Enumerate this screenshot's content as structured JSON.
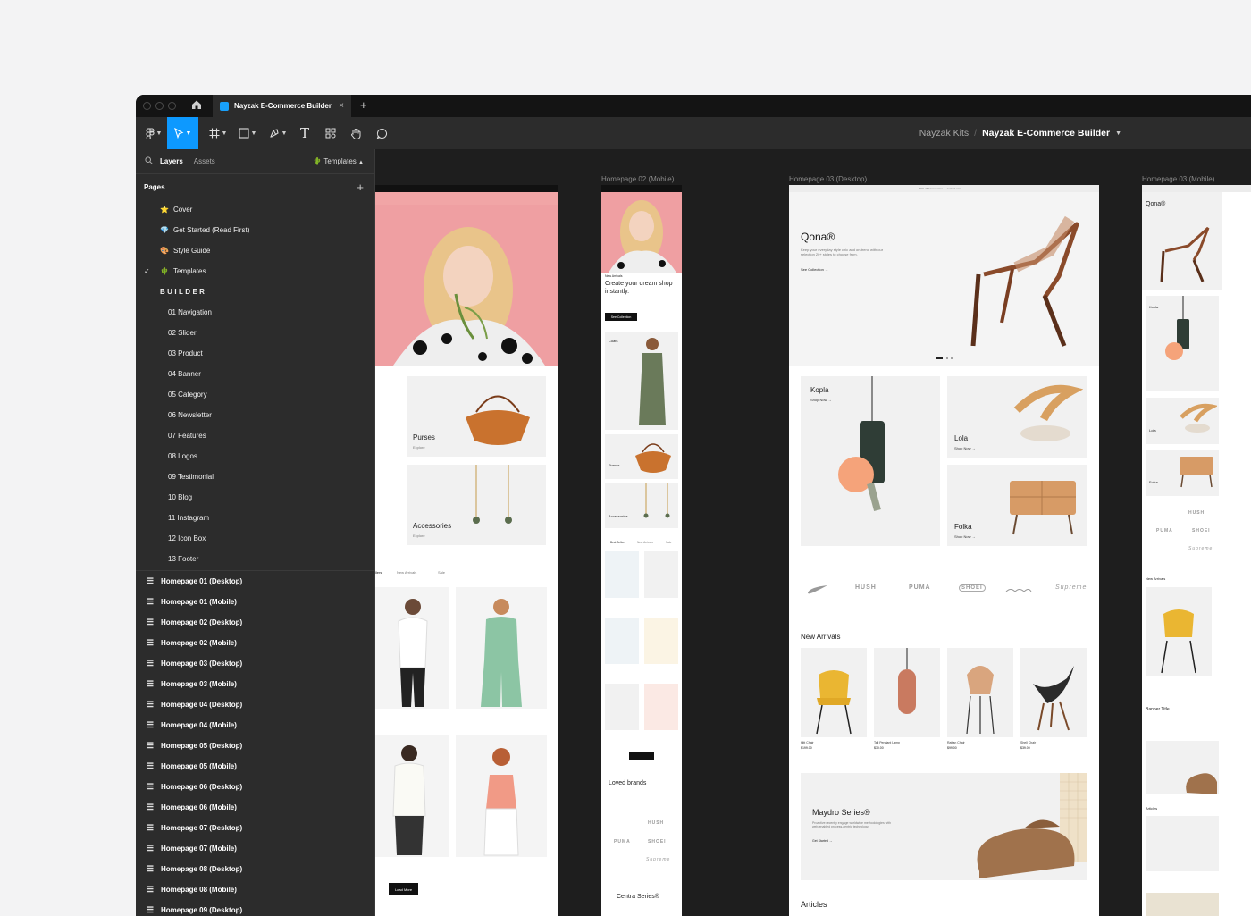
{
  "window": {
    "tab_title": "Nayzak E-Commerce Builder",
    "tab_close": "×",
    "new_tab": "+"
  },
  "toolbar": {
    "tools": [
      "figma-menu",
      "move",
      "frame",
      "shape",
      "pen",
      "text",
      "resources",
      "hand",
      "comment"
    ],
    "text_tool_glyph": "T",
    "breadcrumb_project": "Nayzak Kits",
    "breadcrumb_separator": "/",
    "breadcrumb_file": "Nayzak E-Commerce Builder",
    "accent": "#0d99ff"
  },
  "panel": {
    "tab_layers": "Layers",
    "tab_assets": "Assets",
    "current_page": "Templates",
    "pages_heading": "Pages",
    "add_glyph": "+",
    "pages": [
      {
        "label": "Cover",
        "emoji": "⭐",
        "indent": 1
      },
      {
        "label": "Get Started (Read First)",
        "emoji": "💎",
        "indent": 1
      },
      {
        "label": "Style Guide",
        "emoji": "🎨",
        "indent": 1
      },
      {
        "label": "Templates",
        "emoji": "🌵",
        "indent": 1,
        "checked": true
      },
      {
        "label": "BUILDER",
        "emoji": "",
        "indent": 1,
        "section": true
      },
      {
        "label": "01 Navigation",
        "indent": 2
      },
      {
        "label": "02  Slider",
        "indent": 2
      },
      {
        "label": "03  Product",
        "indent": 2
      },
      {
        "label": "04  Banner",
        "indent": 2
      },
      {
        "label": "05  Category",
        "indent": 2
      },
      {
        "label": "06 Newsletter",
        "indent": 2
      },
      {
        "label": "07 Features",
        "indent": 2
      },
      {
        "label": "08 Logos",
        "indent": 2
      },
      {
        "label": "09  Testimonial",
        "indent": 2
      },
      {
        "label": "10  Blog",
        "indent": 2
      },
      {
        "label": "11  Instagram",
        "indent": 2
      },
      {
        "label": "12 Icon Box",
        "indent": 2
      },
      {
        "label": "13  Footer",
        "indent": 2
      }
    ],
    "frames": [
      "Homepage 01 (Desktop)",
      "Homepage 01 (Mobile)",
      "Homepage 02 (Desktop)",
      "Homepage 02 (Mobile)",
      "Homepage 03 (Desktop)",
      "Homepage 03 (Mobile)",
      "Homepage 04 (Desktop)",
      "Homepage 04 (Mobile)",
      "Homepage 05 (Desktop)",
      "Homepage 05 (Mobile)",
      "Homepage 06 (Desktop)",
      "Homepage 06 (Mobile)",
      "Homepage 07 (Desktop)",
      "Homepage 07 (Mobile)",
      "Homepage 08 (Desktop)",
      "Homepage 08 (Mobile)",
      "Homepage 09 (Desktop)"
    ]
  },
  "canvas": {
    "frame_labels": {
      "h02_mobile": "Homepage 02 (Mobile)",
      "h03_desktop": "Homepage 03 (Desktop)",
      "h03_mobile": "Homepage 03 (Mobile)"
    },
    "h02_desktop": {
      "cat_purses": "Purses",
      "cat_accessories": "Accessories",
      "explore": "Explore",
      "tabs": [
        "llers",
        "New Arrivals",
        "Sale"
      ],
      "load_more": "Load More"
    },
    "h02_mobile": {
      "hero_tag": "New Arrivals",
      "hero_title": "Create your dream shop instantly.",
      "hero_button": "See Collection",
      "cat_coats": "Coats",
      "cat_purses": "Purses",
      "cat_accessories": "Accessories",
      "tabs": [
        "Best Sellers",
        "New Arrivals",
        "Sale"
      ],
      "loved_brands": "Loved brands",
      "centra": "Centra Series®"
    },
    "h03_desktop": {
      "topbar": "70% off Accessories — contact now",
      "brand": "Qona®",
      "hero_sub": "Keep your everyday style chic and on-trend with our selection 20+ styles to choose from.",
      "hero_link": "See Collection →",
      "cat_kopla": "Kopla",
      "cat_lola": "Lola",
      "cat_folka": "Folka",
      "shop_now": "Shop Now →",
      "brands": [
        "HUSH",
        "PUMA",
        "SHOEI",
        "Supreme"
      ],
      "new_arrivals": "New Arrivals",
      "products": [
        {
          "name": "Hitt Chair",
          "price": "$199.00"
        },
        {
          "name": "Tall Pendant Lamp",
          "price": "$30.00"
        },
        {
          "name": "Rattan Chair",
          "price": "$99.00"
        },
        {
          "name": "Shell Chair",
          "price": "$39.00"
        }
      ],
      "banner_title": "Maydro Series®",
      "banner_text": "Proactive recently engage worldwide methodologies with web-enabled process-centric technology.",
      "banner_link": "Get Started →",
      "articles": "Articles"
    },
    "h03_mobile": {
      "brand": "Qona®",
      "cat_kopla": "Kopla",
      "cat_lola": "Lola",
      "cat_folka": "Folka",
      "brands": [
        "HUSH",
        "PUMA",
        "SHOEI",
        "Supreme"
      ],
      "new_arrivals": "New Arrivals",
      "banner_title": "Banner Title",
      "articles": "Articles"
    }
  }
}
